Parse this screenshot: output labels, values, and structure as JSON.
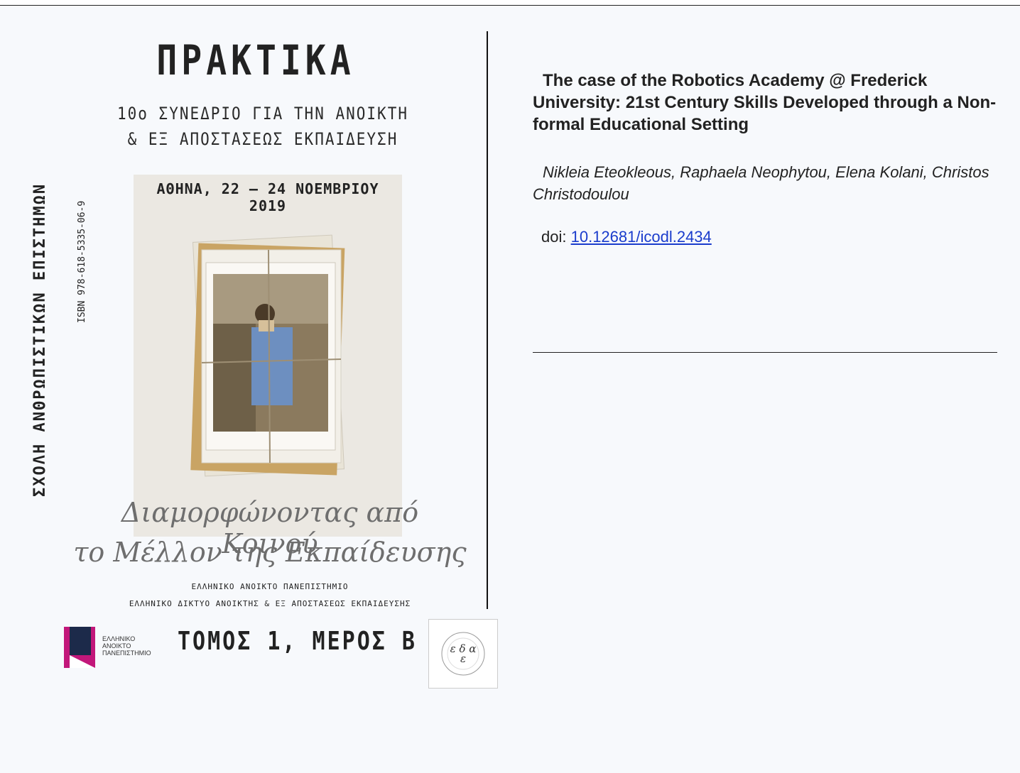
{
  "cover": {
    "title": "ΠΡΑΚΤΙΚΑ",
    "subtitle_line1": "10ο ΣΥΝΕΔΡΙΟ ΓΙΑ ΤΗΝ ΑΝΟΙΚΤΗ",
    "subtitle_line2": "& ΕΞ ΑΠΟΣΤΑΣΕΩΣ ΕΚΠΑΙΔΕΥΣΗ",
    "date": "ΑΘΗΝΑ, 22 – 24 ΝΟΕΜΒΡΙΟΥ 2019",
    "side_text": "ΣΧΟΛΗ ΑΝΘΡΩΠΙΣΤΙΚΩΝ ΕΠΙΣΤΗΜΩΝ",
    "isbn": "ISBN 978-618-5335-06-9",
    "script_line1": "Διαμορφώνοντας από Κοινού",
    "script_line2": "το Μέλλον της Εκπαίδευσης",
    "org_line1": "ΕΛΛΗΝΙΚΟ ΑΝΟΙΚΤΟ ΠΑΝΕΠΙΣΤΗΜΙΟ",
    "org_line2": "ΕΛΛΗΝΙΚΟ ΔΙΚΤΥΟ ΑΝΟΙΚΤΗΣ & ΕΞ ΑΠΟΣΤΑΣΕΩΣ ΕΚΠΑΙΔΕΥΣΗΣ",
    "volume": "ΤΟΜΟΣ 1, ΜΕΡΟΣ Β",
    "eap_logo_text": [
      "ΕΛΛΗΝΙΚΟ",
      "ΑΝΟΙΚΤΟ",
      "ΠΑΝΕΠΙΣΤΗΜΙΟ"
    ],
    "edae_logo_text": "ε δ α ε"
  },
  "article": {
    "title": "The case of the Robotics Academy @ Frederick University: 21st Century Skills Developed through a Non-formal Educational Setting",
    "authors": "Nikleia Eteokleous, Raphaela Neophytou, Elena Kolani, Christos Christodoulou",
    "doi_label": "doi:",
    "doi_value": "10.12681/icodl.2434"
  },
  "colors": {
    "background": "#f7f9fc",
    "link": "#1a3ccc",
    "logo_magenta": "#c2177a",
    "logo_navy": "#1c2a4a"
  }
}
